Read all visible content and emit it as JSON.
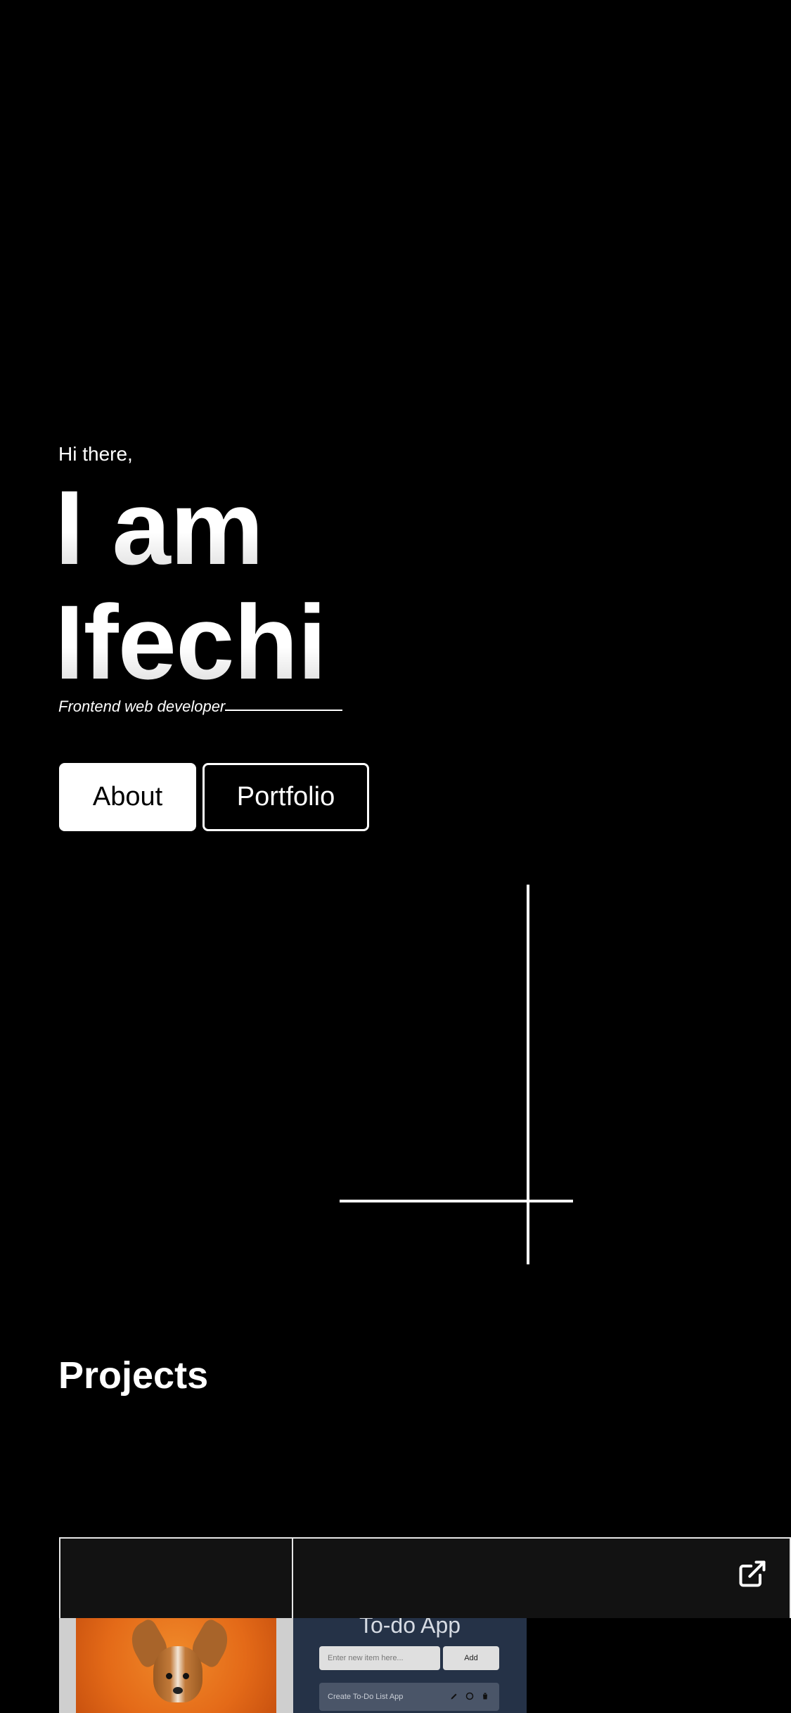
{
  "hero": {
    "greeting": "Hi there,",
    "line1": "I am",
    "line2": "Ifechi",
    "tagline": "Frontend web developer"
  },
  "buttons": {
    "about": "About",
    "portfolio": "Portfolio"
  },
  "projects": {
    "title": "Projects",
    "cards": [
      {
        "thumbnail": "corgi-dog-photo"
      },
      {
        "thumbnail": {
          "title": "To-do App",
          "input_placeholder": "Enter new item here...",
          "add_label": "Add",
          "item": "Create To-Do List App"
        },
        "icon": "external-link-icon"
      }
    ]
  },
  "colors": {
    "background": "#000000",
    "foreground": "#ffffff",
    "card": "#121212",
    "todo_bg": "#253247"
  }
}
